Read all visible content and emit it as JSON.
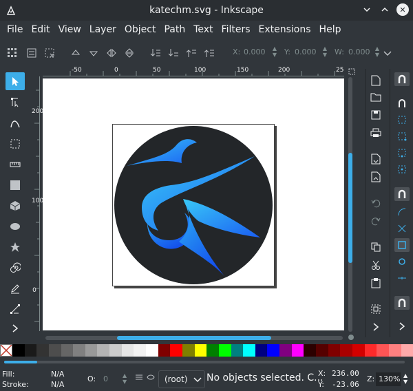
{
  "window": {
    "title": "katechm.svg - Inkscape",
    "controls": [
      "minimize",
      "maximize",
      "close"
    ]
  },
  "menu": [
    "File",
    "Edit",
    "View",
    "Layer",
    "Object",
    "Path",
    "Text",
    "Filters",
    "Extensions",
    "Help"
  ],
  "tool_controls": {
    "x_label": "X:",
    "x_value": "0.000",
    "y_label": "Y:",
    "y_value": "0.000",
    "w_label": "W:",
    "w_value": "0.000"
  },
  "ruler": {
    "top_labels": [
      "-50",
      "0",
      "50",
      "100",
      "150",
      "200",
      "25"
    ],
    "left_labels": [
      "200",
      "100",
      "0"
    ]
  },
  "toolbox": [
    "selector-tool",
    "node-tool",
    "tweak-tool",
    "zoom-tool",
    "measure-tool",
    "rectangle-tool",
    "3d-box-tool",
    "ellipse-tool",
    "star-tool",
    "spiral-tool",
    "pencil-tool",
    "pen-tool"
  ],
  "palette": [
    "#000000",
    "#1a1a1a",
    "#333333",
    "#4d4d4d",
    "#666666",
    "#808080",
    "#999999",
    "#b3b3b3",
    "#cccccc",
    "#e6e6e6",
    "#f2f2f2",
    "#ffffff",
    "#800000",
    "#ff0000",
    "#808000",
    "#ffff00",
    "#008000",
    "#00ff00",
    "#008080",
    "#00ffff",
    "#000080",
    "#0000ff",
    "#800080",
    "#ff00ff",
    "#2b0000",
    "#550000",
    "#800000",
    "#aa0000",
    "#d40000",
    "#ff2a2a",
    "#ff5555",
    "#ff8080",
    "#ffaaaa"
  ],
  "status": {
    "fill_label": "Fill:",
    "fill_value": "N/A",
    "stroke_label": "Stroke:",
    "stroke_value": "N/A",
    "opacity_label": "O:",
    "opacity_value": "0",
    "layer": "(root)",
    "message": "No objects selected. C...",
    "cursor_x_label": "X:",
    "cursor_x": "236.00",
    "cursor_y_label": "Y:",
    "cursor_y": "-23.06",
    "zoom_label": "Z:",
    "zoom": "130%"
  },
  "colors": {
    "accent": "#3daee9",
    "logo_circle": "#232629",
    "logo_blue_light": "#36c3f5",
    "logo_blue_dark": "#1563f0"
  }
}
